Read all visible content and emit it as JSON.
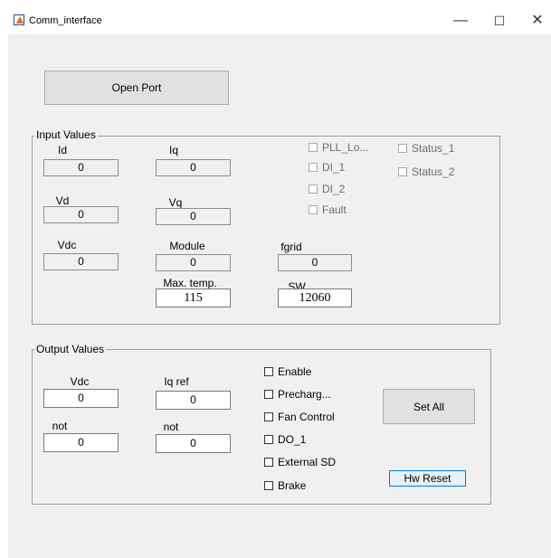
{
  "window": {
    "title": "Comm_interface",
    "controls": {
      "minimize": "—",
      "maximize": "☐",
      "close": "✕"
    }
  },
  "open_port_label": "Open Port",
  "input_values": {
    "title": "Input Values",
    "fields": {
      "id": {
        "label": "Id",
        "value": "0"
      },
      "iq": {
        "label": "Iq",
        "value": "0"
      },
      "vd": {
        "label": "Vd",
        "value": "0"
      },
      "vq": {
        "label": "Vq",
        "value": "0"
      },
      "vdc": {
        "label": "Vdc",
        "value": "0"
      },
      "module": {
        "label": "Module",
        "value": "0"
      },
      "fgrid": {
        "label": "fgrid",
        "value": "0"
      },
      "max_temp": {
        "label": "Max. temp.",
        "value": "115"
      },
      "sw": {
        "label": "SW",
        "value": "12060"
      }
    },
    "checkboxes": {
      "pll_lock": "PLL_Lo...",
      "di_1": "DI_1",
      "di_2": "DI_2",
      "fault": "Fault",
      "status_1": "Status_1",
      "status_2": "Status_2"
    }
  },
  "output_values": {
    "title": "Output Values",
    "fields": {
      "vdc": {
        "label": "Vdc",
        "value": "0"
      },
      "iq_ref": {
        "label": "Iq ref",
        "value": "0"
      },
      "not_1": {
        "label": "not",
        "value": "0"
      },
      "not_2": {
        "label": "not",
        "value": "0"
      }
    },
    "checkboxes": {
      "enable": "Enable",
      "precharge": "Precharg...",
      "fan_control": "Fan Control",
      "do_1": "DO_1",
      "external_sd": "External SD",
      "brake": "Brake"
    },
    "set_all_label": "Set All",
    "hw_reset_label": "Hw Reset"
  }
}
